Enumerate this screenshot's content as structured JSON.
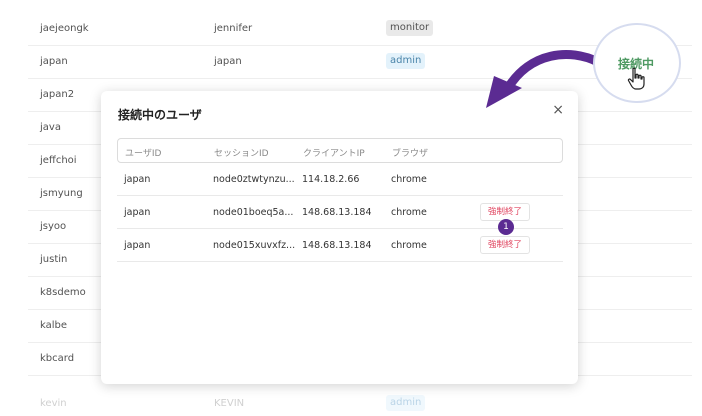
{
  "background_rows": [
    {
      "user": "jaejeongk",
      "name": "jennifer",
      "role": "monitor",
      "role_style": "monitor"
    },
    {
      "user": "japan",
      "name": "japan",
      "role": "admin",
      "role_style": "admin"
    },
    {
      "user": "japan2",
      "name": "",
      "role": "",
      "role_style": "red"
    },
    {
      "user": "java",
      "name": "",
      "role": "",
      "role_style": ""
    },
    {
      "user": "jeffchoi",
      "name": "",
      "role": "",
      "role_style": ""
    },
    {
      "user": "jsmyung",
      "name": "",
      "role": "",
      "role_style": ""
    },
    {
      "user": "jsyoo",
      "name": "",
      "role": "",
      "role_style": ""
    },
    {
      "user": "justin",
      "name": "",
      "role": "",
      "role_style": ""
    },
    {
      "user": "k8sdemo",
      "name": "",
      "role": "",
      "role_style": ""
    },
    {
      "user": "kalbe",
      "name": "",
      "role": "",
      "role_style": ""
    },
    {
      "user": "kbcard",
      "name": "",
      "role": "",
      "role_style": ""
    },
    {
      "user": "kevin",
      "name": "KEVIN",
      "role": "admin",
      "role_style": "admin"
    }
  ],
  "modal": {
    "title": "接続中のユーザ",
    "close_label": "×",
    "columns": [
      "ユーザID",
      "セッションID",
      "クライアントIP",
      "ブラウザ"
    ],
    "rows": [
      {
        "user_id": "japan",
        "session_id": "node0ztwtynzu...",
        "client_ip": "114.18.2.66",
        "browser": "chrome",
        "action": ""
      },
      {
        "user_id": "japan",
        "session_id": "node01boeq5a...",
        "client_ip": "148.68.13.184",
        "browser": "chrome",
        "action": "強制終了"
      },
      {
        "user_id": "japan",
        "session_id": "node015xuvxfz...",
        "client_ip": "148.68.13.184",
        "browser": "chrome",
        "action": "強制終了"
      }
    ]
  },
  "step_badge": "1",
  "callout": {
    "label": "接続中",
    "icon": "hand-pointer-icon"
  },
  "colors": {
    "accent_purple": "#5b2b92",
    "connected_green": "#4f9a63",
    "danger_red": "#e0445f"
  }
}
